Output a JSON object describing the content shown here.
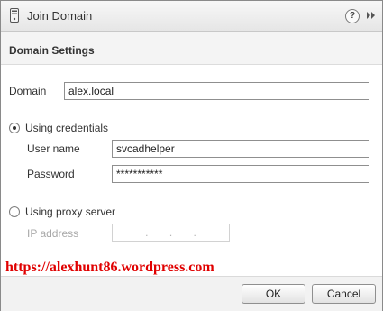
{
  "dialog": {
    "title": "Join Domain",
    "help_symbol": "?",
    "icons": {
      "title": "server-icon",
      "help": "help-icon",
      "forward": "double-chevron-right-icon"
    }
  },
  "section": {
    "title": "Domain Settings"
  },
  "domain": {
    "label": "Domain",
    "value": "alex.local"
  },
  "credentials_option": {
    "label": "Using credentials",
    "selected": true
  },
  "username": {
    "label": "User name",
    "value": "svcadhelper"
  },
  "password": {
    "label": "Password",
    "value": "***********"
  },
  "proxy_option": {
    "label": "Using proxy server",
    "selected": false
  },
  "ip_address": {
    "label": "IP address",
    "value": ".       .       ."
  },
  "watermark": "https://alexhunt86.wordpress.com",
  "buttons": {
    "ok": "OK",
    "cancel": "Cancel"
  }
}
